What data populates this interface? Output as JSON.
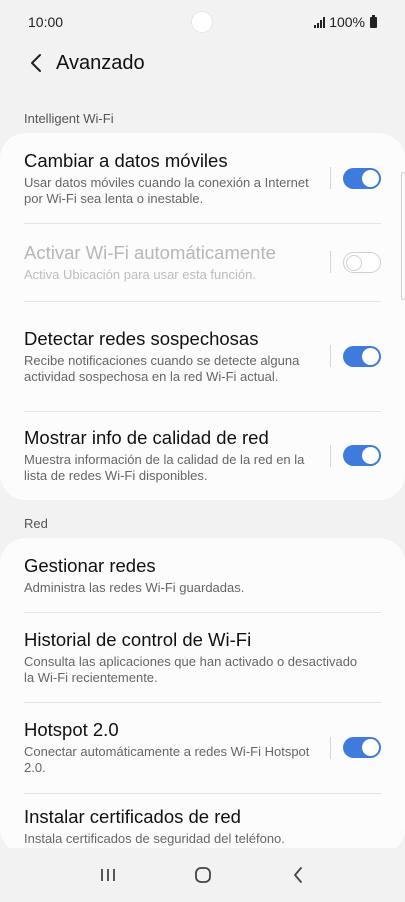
{
  "status": {
    "time": "10:00",
    "battery": "100%"
  },
  "header": {
    "title": "Avanzado"
  },
  "sections": {
    "intelligent": "Intelligent Wi-Fi",
    "red": "Red"
  },
  "items": [
    {
      "title": "Cambiar a datos móviles",
      "sub": "Usar datos móviles cuando la conexión a Internet por Wi-Fi sea lenta o inestable.",
      "toggle": "on"
    },
    {
      "title": "Activar Wi-Fi automáticamente",
      "sub": "Activa Ubicación para usar esta función.",
      "toggle": "off",
      "disabled": true
    },
    {
      "title": "Detectar redes sospechosas",
      "sub": "Recibe notificaciones cuando se detecte alguna actividad sospechosa en la red Wi-Fi actual.",
      "toggle": "on"
    },
    {
      "title": "Mostrar info de calidad de red",
      "sub": "Muestra información de la calidad de la red en la lista de redes Wi-Fi disponibles.",
      "toggle": "on"
    },
    {
      "title": "Gestionar redes",
      "sub": "Administra las redes Wi-Fi guardadas."
    },
    {
      "title": "Historial de control de Wi-Fi",
      "sub": "Consulta las aplicaciones que han activado o desactivado la Wi-Fi recientemente."
    },
    {
      "title": "Hotspot 2.0",
      "sub": "Conectar automáticamente a redes Wi-Fi Hotspot 2.0.",
      "toggle": "on"
    },
    {
      "title": "Instalar certificados de red",
      "sub": "Instala certificados de seguridad del teléfono."
    }
  ],
  "colors": {
    "accent": "#3e7bdc",
    "background": "#f2f2f2",
    "card": "#fcfcfc"
  },
  "icons": {
    "back": "chevron-left-icon",
    "recents": "recents-icon",
    "home": "home-icon",
    "nav_back": "back-icon"
  }
}
